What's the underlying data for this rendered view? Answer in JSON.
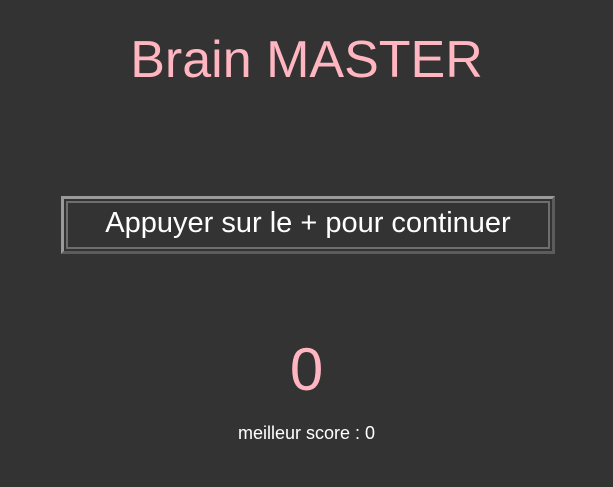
{
  "app": {
    "title": "Brain MASTER"
  },
  "main": {
    "continue_button_label": "Appuyer sur le + pour continuer",
    "score": "0",
    "best_score_text": "meilleur score : 0"
  },
  "colors": {
    "background": "#333333",
    "accent": "#ffb6c1",
    "text": "#ffffff"
  }
}
